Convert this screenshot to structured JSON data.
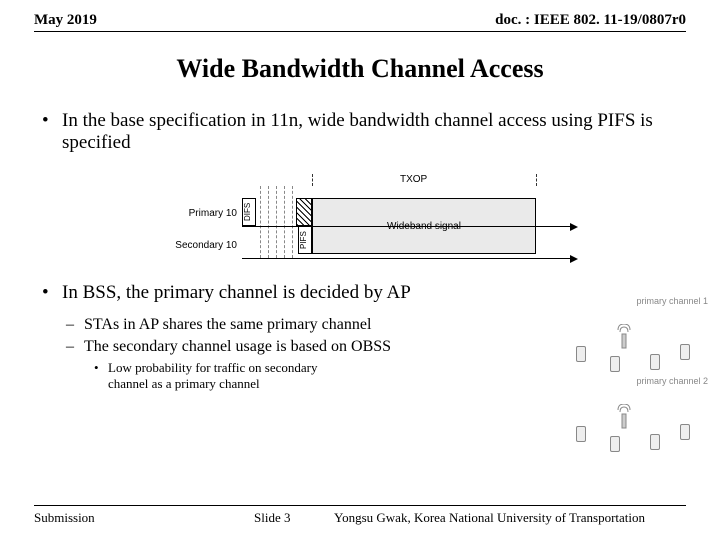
{
  "header": {
    "date": "May 2019",
    "docid": "doc. : IEEE 802. 11-19/0807r0"
  },
  "title": "Wide Bandwidth Channel Access",
  "bullets": {
    "main1": "In the base specification in 11n, wide bandwidth channel access using PIFS is specified",
    "main2": "In BSS, the primary channel is decided by AP",
    "sub1": "STAs in AP shares the same primary channel",
    "sub2": "The secondary channel usage is based on OBSS",
    "subsub1": "Low probability for traffic on secondary channel as a primary channel"
  },
  "diagram": {
    "txop": "TXOP",
    "primary": "Primary 10",
    "secondary": "Secondary 10",
    "difs": "DIFS",
    "pifs": "PIFS",
    "wideband": "Wideband signal"
  },
  "illustration": {
    "label1": "primary channel 1",
    "label2": "primary channel 2"
  },
  "footer": {
    "submission": "Submission",
    "slide": "Slide 3",
    "author": "Yongsu Gwak, Korea National University of Transportation"
  }
}
